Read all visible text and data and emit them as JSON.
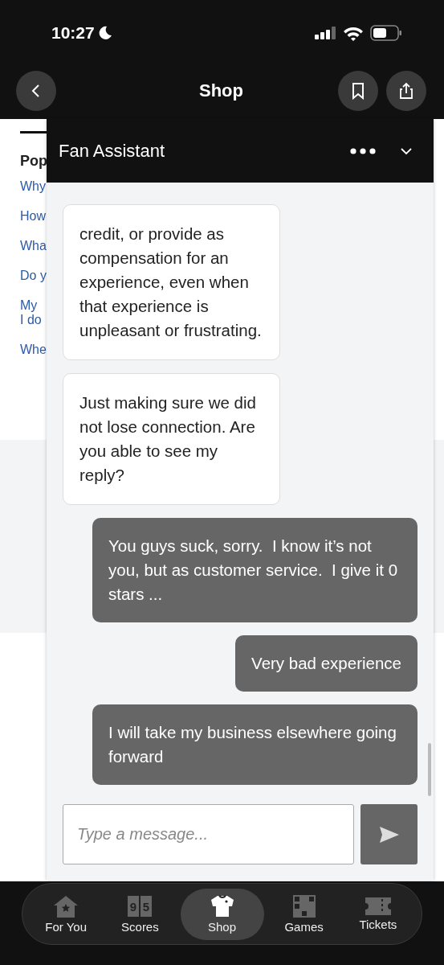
{
  "status_bar": {
    "time": "10:27"
  },
  "nav": {
    "title": "Shop"
  },
  "background_page": {
    "heading": "Pop",
    "links": [
      "Why",
      "How",
      "Wha",
      "Do y",
      "My \nI do",
      "Whe"
    ]
  },
  "chat": {
    "title": "Fan Assistant",
    "messages": [
      {
        "kind": "agent",
        "text": "credit, or provide as compensation for an experience, even when that experience is unpleasant or frustrating."
      },
      {
        "kind": "agent",
        "text": "Just making sure we did not lose connection. Are you able to see my reply?"
      },
      {
        "kind": "user",
        "text": "You guys suck, sorry.  I know it’s not you, but as customer service.  I give it 0 stars ..."
      },
      {
        "kind": "user",
        "text": "Very bad experience"
      },
      {
        "kind": "user",
        "text": "I will take my business elsewhere going forward"
      }
    ],
    "input": {
      "placeholder": "Type a message..."
    }
  },
  "tab_bar": [
    {
      "label": "For You",
      "kind": "home",
      "selected": false
    },
    {
      "label": "Scores",
      "kind": "scoreboard",
      "digits": [
        "9",
        "5"
      ],
      "selected": false
    },
    {
      "label": "Shop",
      "kind": "shirt",
      "selected": true
    },
    {
      "label": "Games",
      "kind": "grid",
      "selected": false
    },
    {
      "label": "Tickets",
      "kind": "ticket",
      "selected": false
    }
  ]
}
